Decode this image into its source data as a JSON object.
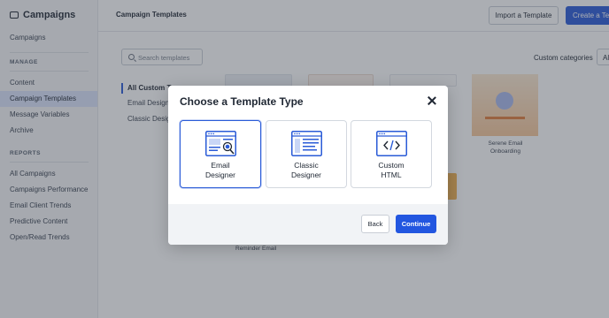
{
  "sidebar": {
    "brand": "Campaigns",
    "top_items": [
      {
        "label": "Campaigns"
      }
    ],
    "manage": {
      "heading": "MANAGE",
      "items": [
        {
          "label": "Content"
        },
        {
          "label": "Campaign Templates"
        },
        {
          "label": "Message Variables"
        },
        {
          "label": "Archive"
        }
      ]
    },
    "reports": {
      "heading": "REPORTS",
      "items": [
        {
          "label": "All Campaigns"
        },
        {
          "label": "Campaigns Performance"
        },
        {
          "label": "Email Client Trends"
        },
        {
          "label": "Predictive Content"
        },
        {
          "label": "Open/Read Trends"
        }
      ]
    }
  },
  "header": {
    "title": "Campaign Templates",
    "import_label": "Import a Template",
    "create_label": "Create a Te"
  },
  "content": {
    "search_placeholder": "Search templates",
    "custom_categories_label": "Custom categories",
    "category_value": "Al",
    "filters": [
      {
        "label": "All Custom Te"
      },
      {
        "label": "Email Design"
      },
      {
        "label": "Classic Desig"
      }
    ],
    "serene_label": "Serene Email Onboarding",
    "reminder_label": "Reminder Email"
  },
  "modal": {
    "title": "Choose a Template Type",
    "options": [
      {
        "label": "Email\nDesigner",
        "icon": "email-designer-icon",
        "selected": true
      },
      {
        "label": "Classic\nDesigner",
        "icon": "classic-designer-icon",
        "selected": false
      },
      {
        "label": "Custom\nHTML",
        "icon": "code-icon",
        "selected": false
      }
    ],
    "back_label": "Back",
    "continue_label": "Continue"
  },
  "colors": {
    "primary": "#2256e0",
    "selected_nav": "#dbe4fb",
    "overlay": "rgba(55,62,74,0.42)"
  }
}
